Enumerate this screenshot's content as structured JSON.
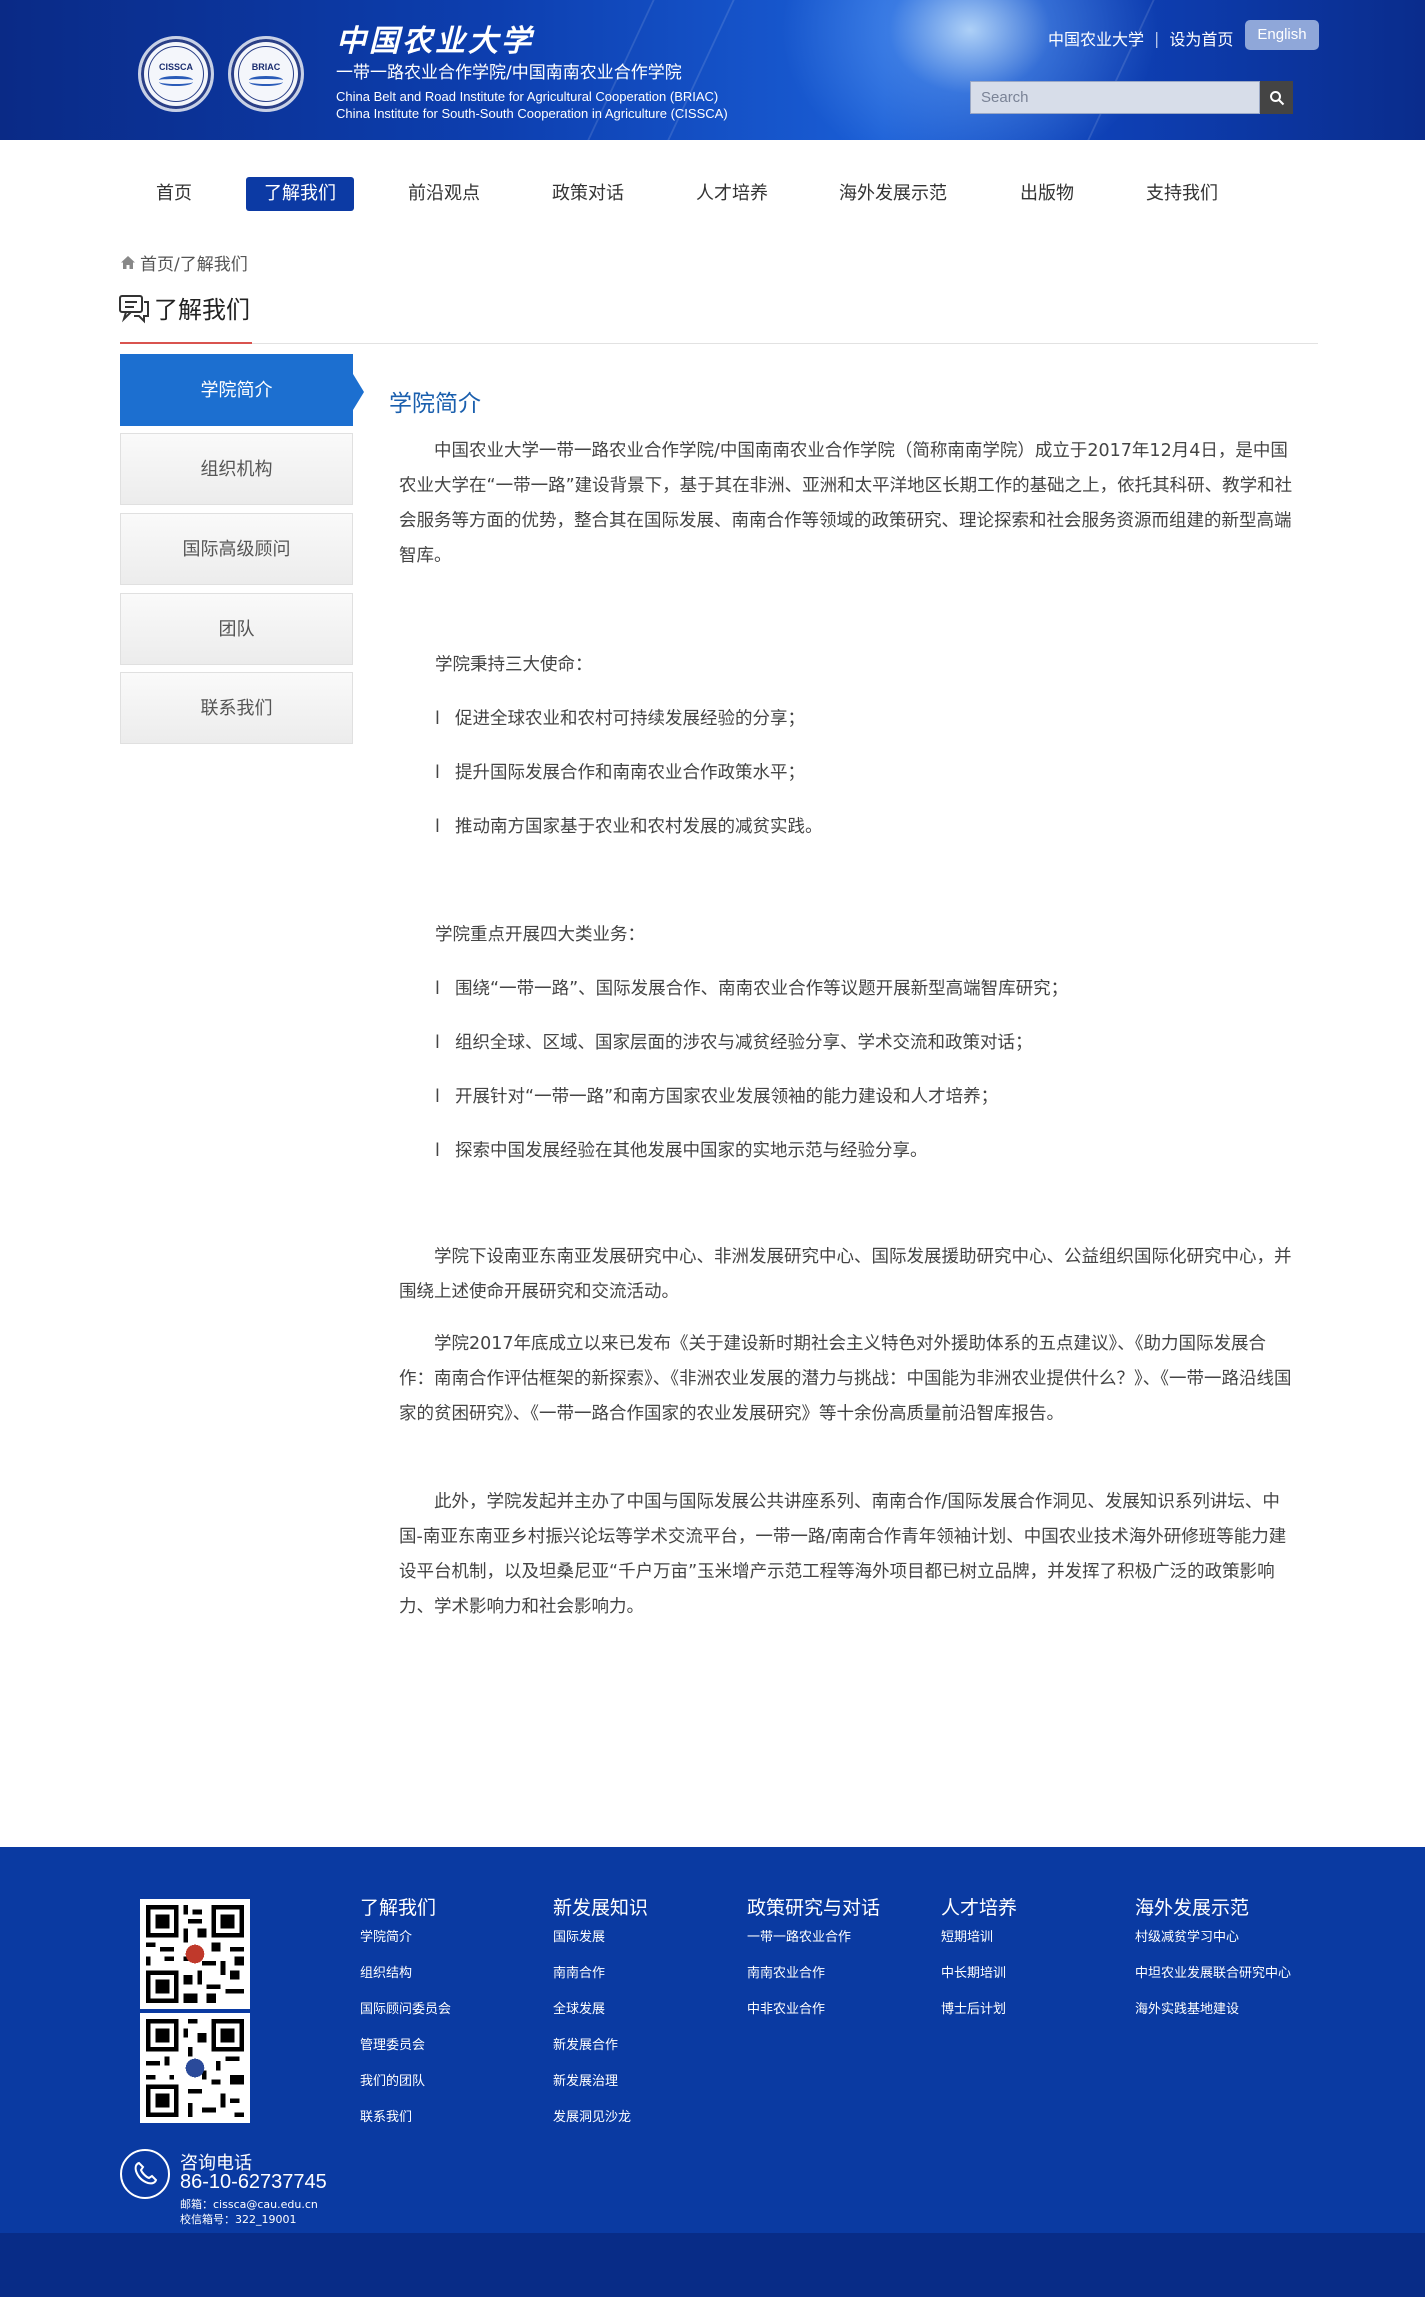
{
  "header": {
    "seal_left_text": "CISSCA",
    "seal_right_text": "BRIAC",
    "logo_cn": "中国农业大学",
    "logo_sub": "一带一路农业合作学院/中国南南农业合作学院",
    "logo_en_line1": "China Belt and Road Institute for Agricultural Cooperation (BRIAC)",
    "logo_en_line2": "China Institute for South-South Cooperation in Agriculture (CISSCA)",
    "link_university": "中国农业大学",
    "link_sep": "|",
    "link_homepage": "设为首页",
    "english_button": "English",
    "search_placeholder": "Search",
    "search_icon": "search-icon",
    "colors": {
      "header_dark": "#0a2a86",
      "header_light": "#1a5ed6",
      "english_button_bg": "#8fa7d9"
    }
  },
  "nav": {
    "items": [
      "首页",
      "了解我们",
      "前沿观点",
      "政策对话",
      "人才培养",
      "海外发展示范",
      "出版物",
      "支持我们"
    ],
    "active_index": 1,
    "active_color": "#0c3aa4"
  },
  "breadcrumb": {
    "icon": "home-icon",
    "text": "首页/了解我们"
  },
  "page_title": {
    "icon": "chat-icon",
    "text": "了解我们"
  },
  "sidebar": {
    "items": [
      "学院简介",
      "组织机构",
      "国际高级顾问",
      "团队",
      "联系我们"
    ],
    "active_index": 0,
    "active_color": "#1c6fd0"
  },
  "article": {
    "heading": "学院简介",
    "intro": "中国农业大学一带一路农业合作学院/中国南南农业合作学院（简称南南学院）成立于2017年12月4日，是中国农业大学在“一带一路”建设背景下，基于其在非洲、亚洲和太平洋地区长期工作的基础之上，依托其科研、教学和社会服务等方面的优势，整合其在国际发展、南南合作等领域的政策研究、理论探索和社会服务资源而组建的新型高端智库。",
    "missions_title": "学院秉持三大使命：",
    "bullet_mark": "l",
    "missions": [
      "促进全球农业和农村可持续发展经验的分享；",
      "提升国际发展合作和南南农业合作政策水平；",
      "推动南方国家基于农业和农村发展的减贫实践。"
    ],
    "business_title": "学院重点开展四大类业务：",
    "business": [
      "围绕“一带一路”、国际发展合作、南南农业合作等议题开展新型高端智库研究；",
      "组织全球、区域、国家层面的涉农与减贫经验分享、学术交流和政策对话；",
      "开展针对“一带一路”和南方国家农业发展领袖的能力建设和人才培养；",
      "探索中国发展经验在其他发展中国家的实地示范与经验分享。"
    ],
    "para_centers": "学院下设南亚东南亚发展研究中心、非洲发展研究中心、国际发展援助研究中心、公益组织国际化研究中心，并围绕上述使命开展研究和交流活动。",
    "para_reports": "学院2017年底成立以来已发布《关于建设新时期社会主义特色对外援助体系的五点建议》、《助力国际发展合作：南南合作评估框架的新探索》、《非洲农业发展的潜力与挑战：中国能为非洲农业提供什么？》、《一带一路沿线国家的贫困研究》、《一带一路合作国家的农业发展研究》等十余份高质量前沿智库报告。",
    "para_platforms": "此外，学院发起并主办了中国与国际发展公共讲座系列、南南合作/国际发展合作洞见、发展知识系列讲坛、中国-南亚东南亚乡村振兴论坛等学术交流平台，一带一路/南南合作青年领袖计划、中国农业技术海外研修班等能力建设平台机制，以及坦桑尼亚“千户万亩”玉米增产示范工程等海外项目都已树立品牌，并发挥了积极广泛的政策影响力、学术影响力和社会影响力。"
  },
  "footer": {
    "qr_icons": [
      "qr-code-wechat-icon",
      "qr-code-site-icon"
    ],
    "columns": [
      {
        "title": "了解我们",
        "links": [
          "学院简介",
          "组织结构",
          "国际顾问委员会",
          "管理委员会",
          "我们的团队",
          "联系我们"
        ]
      },
      {
        "title": "新发展知识",
        "links": [
          "国际发展",
          "南南合作",
          "全球发展",
          "新发展合作",
          "新发展治理",
          "发展洞见沙龙"
        ]
      },
      {
        "title": "政策研究与对话",
        "links": [
          "一带一路农业合作",
          "南南农业合作",
          "中非农业合作"
        ]
      },
      {
        "title": "人才培养",
        "links": [
          "短期培训",
          "中长期培训",
          "博士后计划"
        ]
      },
      {
        "title": "海外发展示范",
        "links": [
          "村级减贫学习中心",
          "中坦农业发展联合研究中心",
          "海外实践基地建设"
        ]
      }
    ],
    "phone_label": "咨询电话",
    "phone_number": "86-10-62737745",
    "email": "邮箱：cissca@cau.edu.cn",
    "mailbox": "校信箱号：322_19001",
    "colors": {
      "footer_bg": "#0a3aa2",
      "footer_bottom": "#082c87"
    }
  }
}
